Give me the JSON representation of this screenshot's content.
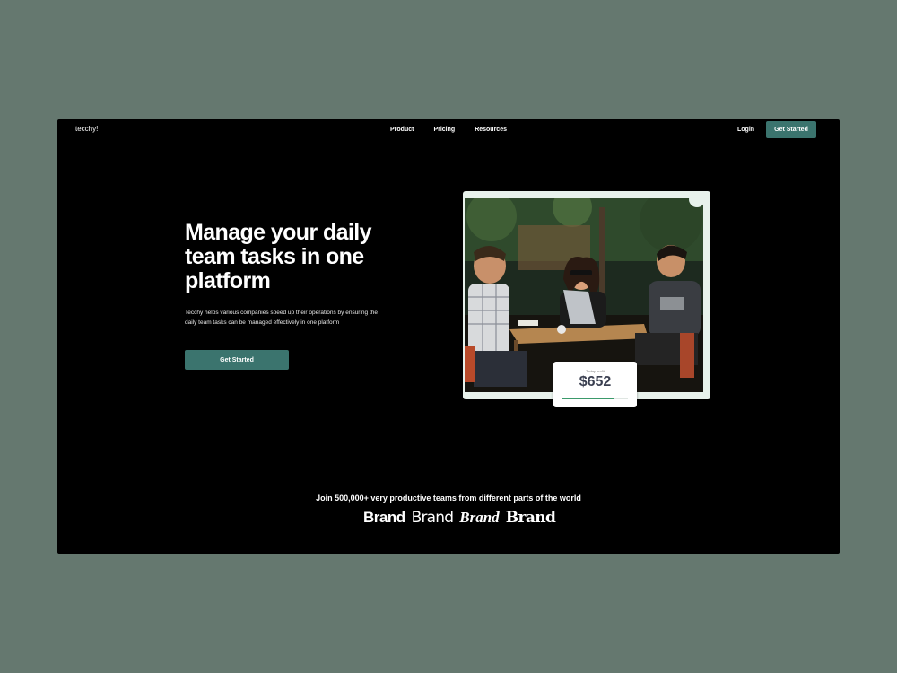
{
  "nav": {
    "logo": "tecchy!",
    "menu": [
      "Product",
      "Pricing",
      "Resources"
    ],
    "login": "Login",
    "cta": "Get Started"
  },
  "hero": {
    "title": "Manage your daily team tasks in one platform",
    "description": "Tecchy helps various companies speed up their operations by ensuring the daily team tasks can be managed effectively in one platform",
    "cta": "Get Started"
  },
  "stat": {
    "label": "Today profit",
    "value": "$652",
    "progress": 0.8
  },
  "social_proof": {
    "text": "Join 500,000+ very productive teams from different parts of the world",
    "brands": [
      "Brand",
      "Brand",
      "Brand",
      "Brand"
    ]
  },
  "colors": {
    "background": "#65786f",
    "accent": "#3b746e",
    "page": "#000000"
  }
}
